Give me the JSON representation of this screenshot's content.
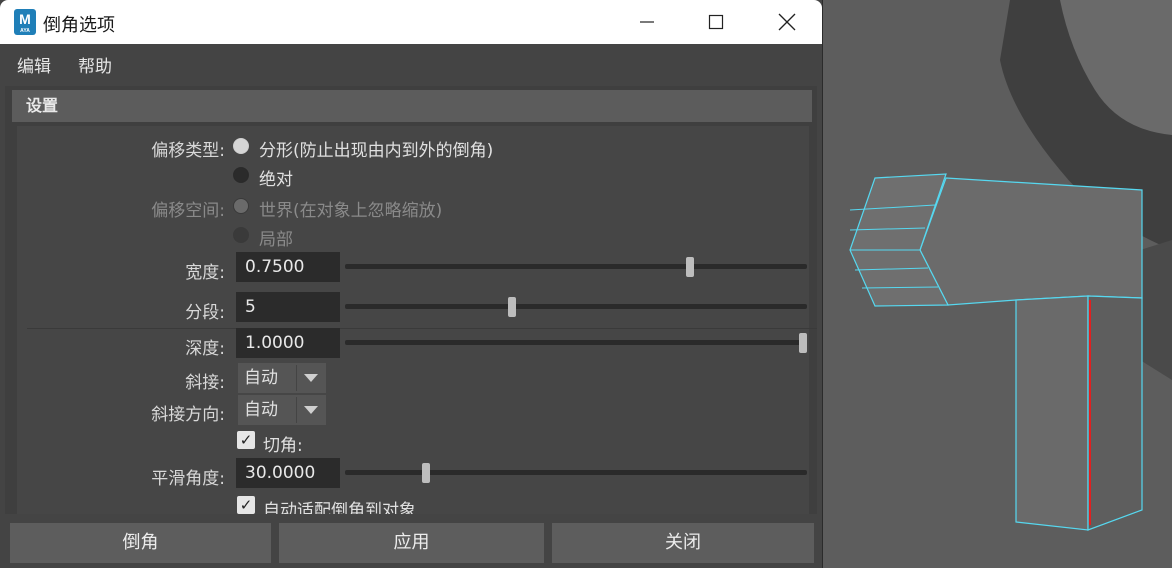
{
  "window": {
    "title": "倒角选项",
    "app_icon_letter": "M",
    "app_icon_sub": "AYA"
  },
  "menu": {
    "edit": "编辑",
    "help": "帮助"
  },
  "section": {
    "title": "设置"
  },
  "offset_type": {
    "label": "偏移类型:",
    "option1": "分形(防止出现由内到外的倒角)",
    "option2": "绝对",
    "selected": "option1"
  },
  "offset_space": {
    "label": "偏移空间:",
    "option1": "世界(在对象上忽略缩放)",
    "option2": "局部"
  },
  "width": {
    "label": "宽度:",
    "value": "0.7500",
    "slider_fraction": 0.75
  },
  "segments": {
    "label": "分段:",
    "value": "5",
    "slider_fraction": 0.36
  },
  "depth": {
    "label": "深度:",
    "value": "1.0000",
    "slider_fraction": 1.0
  },
  "miter": {
    "label": "斜接:",
    "value": "自动"
  },
  "miter_along": {
    "label": "斜接方向:",
    "value": "自动"
  },
  "chamfer": {
    "label": "切角:",
    "checked": true
  },
  "smoothing_angle": {
    "label": "平滑角度:",
    "value": "30.0000",
    "slider_fraction": 0.17
  },
  "auto_fit": {
    "label": "自动适配倒角到对象",
    "checked": true
  },
  "buttons": {
    "bevel": "倒角",
    "apply": "应用",
    "close": "关闭"
  },
  "colors": {
    "selection_outline": "#56d8f0",
    "edge_highlight": "#e02020",
    "viewport_bg": "#5d5d5d"
  }
}
